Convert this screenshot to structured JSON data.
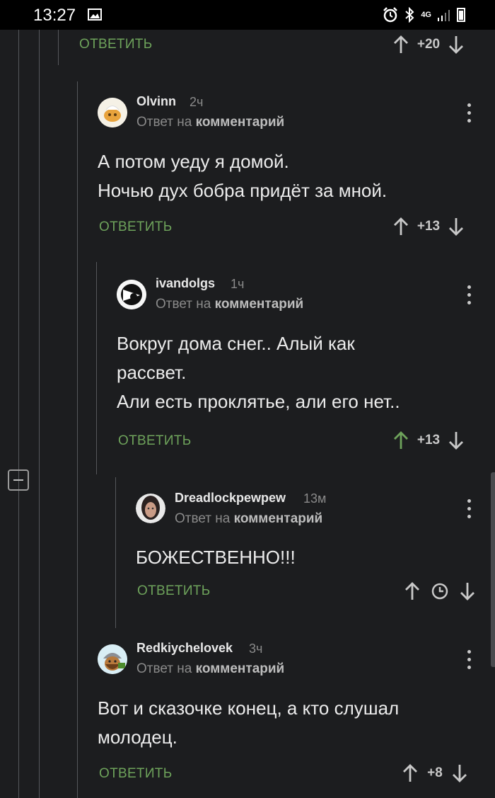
{
  "status_bar": {
    "time": "13:27",
    "network": "4G"
  },
  "reply_label": "ОТВЕТИТЬ",
  "reply_to_prefix": "Ответ на",
  "reply_to_target": "комментарий",
  "top_comment": {
    "rating": "+20"
  },
  "comments": [
    {
      "author": "Olvinn",
      "ago": "2ч",
      "text": "А потом уеду я домой.\nНочью дух бобра придёт за мной.",
      "rating": "+13",
      "upvoted": false
    },
    {
      "author": "ivandolgs",
      "ago": "1ч",
      "text": "Вокруг дома снег.. Алый как рассвет.\nАли есть проклятье, али его нет..",
      "rating": "+13",
      "upvoted": true
    },
    {
      "author": "Dreadlockpewpew",
      "ago": "13м",
      "text": "БОЖЕСТВЕННО!!!",
      "rating": null,
      "upvoted": false
    },
    {
      "author": "Redkiychelovek",
      "ago": "3ч",
      "text": "Вот и сказочке конец, а кто слушал молодец.",
      "rating": "+8",
      "upvoted": false
    }
  ],
  "colors": {
    "accent_green": "#6ea35b",
    "background": "#1c1d1f",
    "upvoted_arrow": "#6ea35b"
  },
  "icons": [
    "up-arrow-icon",
    "down-arrow-icon",
    "kebab-menu-icon",
    "clock-icon",
    "collapse-thread-icon"
  ]
}
